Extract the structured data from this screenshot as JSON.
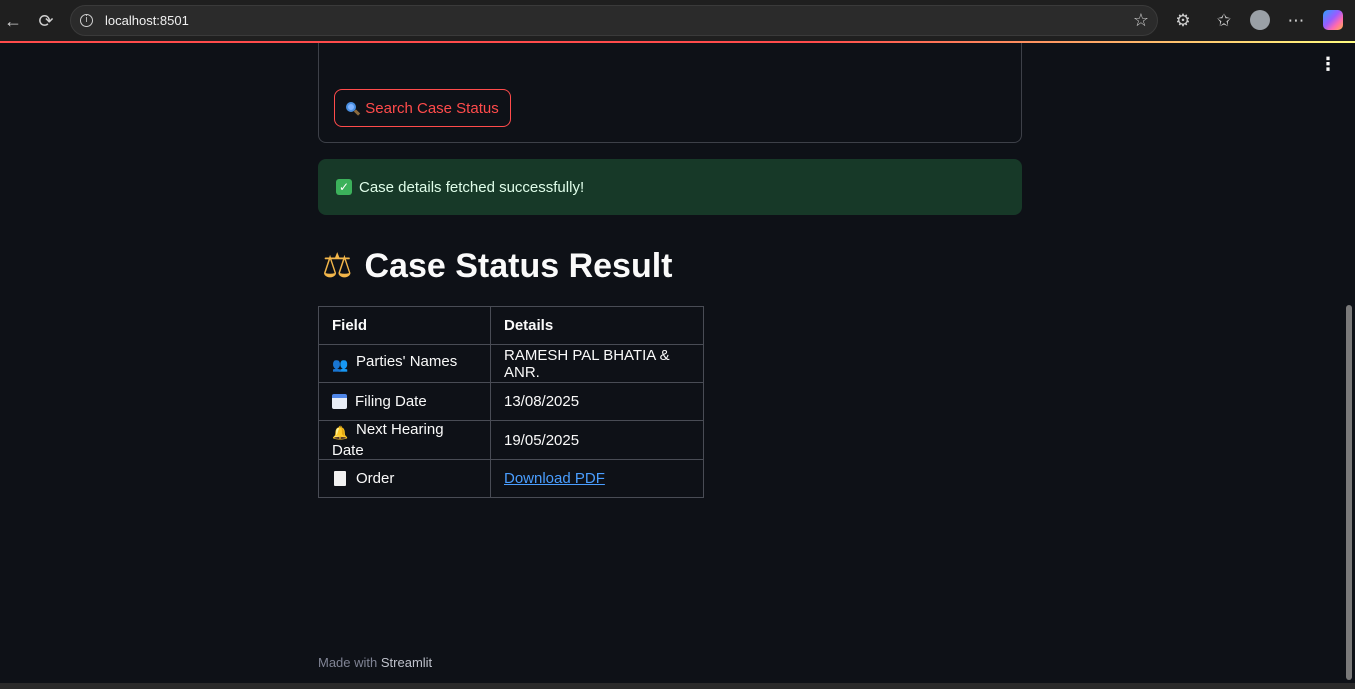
{
  "browser": {
    "url": "localhost:8501",
    "back_glyph": "←",
    "reload_glyph": "⟳",
    "info_glyph": "i",
    "star_glyph": "☆",
    "extensions_glyph": "⚙",
    "favorites_glyph": "✩",
    "more_glyph": "⋯"
  },
  "app": {
    "menu_glyph": "⋮",
    "search_button_label": "Search Case Status",
    "success_message": "Case details fetched successfully!",
    "success_check_glyph": "✓",
    "result_title": "Case Status Result",
    "title_icon_glyph": "⚖"
  },
  "table": {
    "headers": [
      "Field",
      "Details"
    ],
    "rows": [
      {
        "icon": "people-icon",
        "field": "Parties' Names",
        "value": "RAMESH PAL BHATIA & ANR."
      },
      {
        "icon": "calendar-icon",
        "field": "Filing Date",
        "value": "13/08/2025"
      },
      {
        "icon": "bell-icon",
        "field": "Next Hearing Date",
        "value": "19/05/2025"
      },
      {
        "icon": "document-icon",
        "field": "Order",
        "value": "Download PDF"
      }
    ]
  },
  "footer": {
    "prefix": "Made with",
    "brand": "Streamlit"
  },
  "colors": {
    "background": "#0e1117",
    "accent": "#ff4b4b",
    "success_bg": "#173928",
    "link": "#4a9eff"
  }
}
